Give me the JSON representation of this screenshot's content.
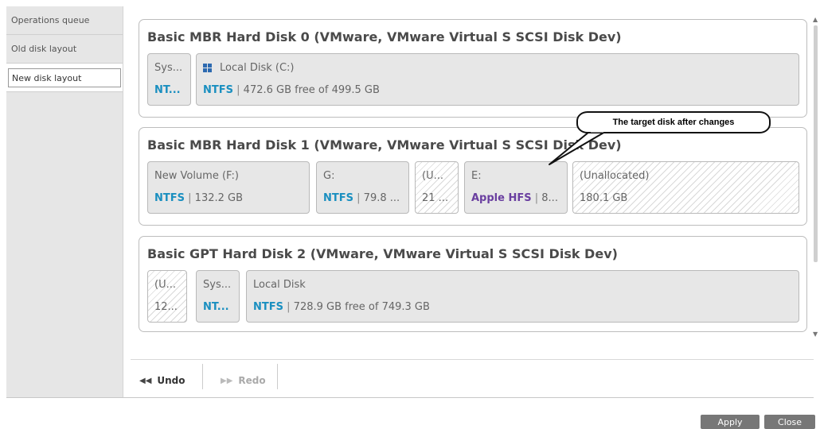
{
  "sidebar": {
    "items": [
      {
        "label": "Operations queue"
      },
      {
        "label": "Old disk layout"
      },
      {
        "label": "New disk layout"
      }
    ]
  },
  "disks": [
    {
      "title": "Basic MBR Hard Disk 0 (VMware, VMware Virtual S SCSI Disk Dev)",
      "partitions": [
        {
          "name": "Sys...",
          "fs": "NT...",
          "detail": ""
        },
        {
          "name": "Local Disk (C:)",
          "fs": "NTFS",
          "detail": "472.6 GB free of 499.5 GB",
          "icon": "windows-icon"
        }
      ]
    },
    {
      "title": "Basic MBR Hard Disk 1 (VMware, VMware Virtual S SCSI Disk Dev)",
      "partitions": [
        {
          "name": "New Volume (F:)",
          "fs": "NTFS",
          "detail": "132.2 GB"
        },
        {
          "name": "G:",
          "fs": "NTFS",
          "detail": "79.8 ..."
        },
        {
          "name": "(U...",
          "fs": "",
          "detail": "21 ..."
        },
        {
          "name": "E:",
          "fs": "Apple HFS",
          "detail": "8..."
        },
        {
          "name": "(Unallocated)",
          "fs": "",
          "detail": "180.1 GB"
        }
      ]
    },
    {
      "title": "Basic GPT Hard Disk 2 (VMware, VMware Virtual S SCSI Disk Dev)",
      "partitions": [
        {
          "name": "(U...",
          "fs": "",
          "detail": "12..."
        },
        {
          "name": "Sys...",
          "fs": "NT...",
          "detail": ""
        },
        {
          "name": "Local Disk",
          "fs": "NTFS",
          "detail": "728.9 GB free of 749.3 GB"
        }
      ]
    }
  ],
  "toolbar": {
    "undo_label": "Undo",
    "redo_label": "Redo"
  },
  "footer": {
    "apply_label": "Apply",
    "close_label": "Close"
  },
  "callout": {
    "text": "The target disk after changes"
  },
  "separator": "|",
  "colors": {
    "fs_ntfs": "#1a8fc0",
    "fs_hfs": "#6a3fa0",
    "footer_button": "#777777"
  }
}
